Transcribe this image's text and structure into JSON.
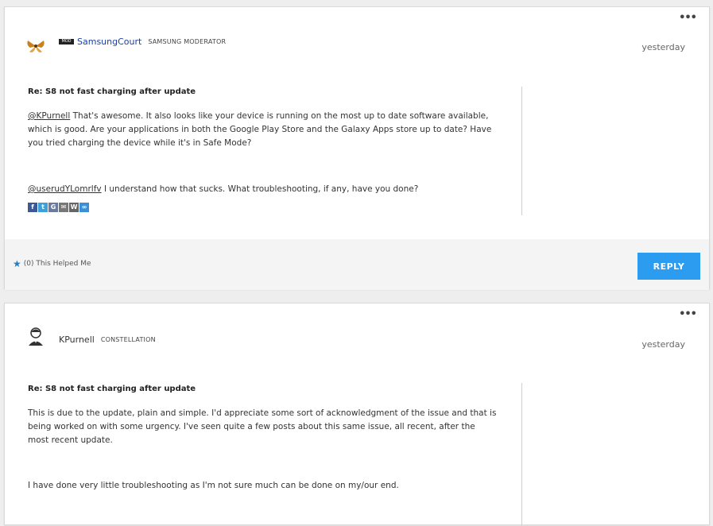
{
  "posts": [
    {
      "author": "SamsungCourt",
      "badge": "MOD",
      "rank": "SAMSUNG MODERATOR",
      "date": "yesterday",
      "subject": "Re: S8 not fast charging after update",
      "p1_mention": "@KPurnell",
      "p1_text": " That's awesome. It also looks like your device is running on the most up to date software available, which is good. Are your applications in both the Google Play Store and the Galaxy Apps store up to date? Have you tried charging the device while it's in Safe Mode?",
      "p2_mention": "@userudYLomrlfv",
      "p2_text": " I understand how that sucks. What troubleshooting, if any, have you done?",
      "share_icons": [
        {
          "name": "facebook-icon",
          "glyph": "f",
          "color": "#3b5998"
        },
        {
          "name": "twitter-icon",
          "glyph": "t",
          "color": "#3da0d8"
        },
        {
          "name": "google-icon",
          "glyph": "G",
          "color": "#6b7ba0"
        },
        {
          "name": "email-icon",
          "glyph": "✉",
          "color": "#777777"
        },
        {
          "name": "wordpress-icon",
          "glyph": "W",
          "color": "#666666"
        },
        {
          "name": "link-icon",
          "glyph": "∞",
          "color": "#3a8fd6"
        }
      ],
      "helped_label": "(0) This Helped Me",
      "reply_label": "REPLY"
    },
    {
      "author": "KPurnell",
      "rank": "CONSTELLATION",
      "date": "yesterday",
      "subject": "Re: S8 not fast charging after update",
      "p1_text": "This is due to the update, plain and simple. I'd appreciate some sort of acknowledgment of the issue and that is being worked on with some urgency.  I've seen quite a few posts about this same issue, all recent, after the most recent update.",
      "p2_text": "I have done very little troubleshooting as I'm not sure much can be done on my/our end."
    }
  ],
  "more_label": "•••"
}
